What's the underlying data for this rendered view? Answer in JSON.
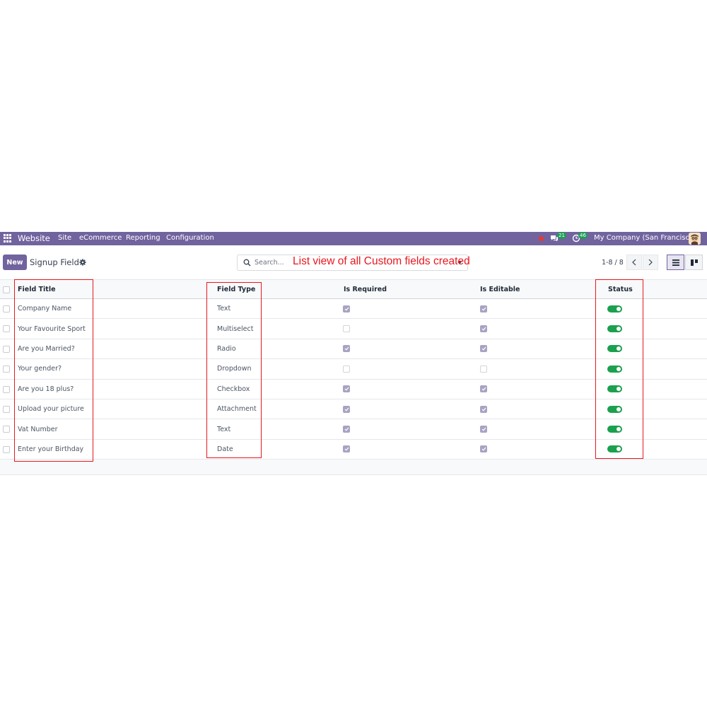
{
  "navbar": {
    "app_name": "Website",
    "menu": [
      "Site",
      "eCommerce",
      "Reporting",
      "Configuration"
    ],
    "messages_count": "21",
    "activities_count": "46",
    "company": "My Company (San Francisco)"
  },
  "control_panel": {
    "new_label": "New",
    "title": "Signup Field",
    "search_placeholder": "Search...",
    "pager_value": "1-8 / 8"
  },
  "annotation": {
    "text": "List view of all Custom fields created",
    "color": "#e8171f"
  },
  "table": {
    "headers": {
      "field_title": "Field Title",
      "field_type": "Field Type",
      "is_required": "Is Required",
      "is_editable": "Is Editable",
      "status": "Status"
    },
    "rows": [
      {
        "title": "Company Name",
        "type": "Text",
        "required": true,
        "editable": true,
        "status": true
      },
      {
        "title": "Your Favourite Sport",
        "type": "Multiselect",
        "required": false,
        "editable": true,
        "status": true
      },
      {
        "title": "Are you Married?",
        "type": "Radio",
        "required": true,
        "editable": true,
        "status": true
      },
      {
        "title": "Your gender?",
        "type": "Dropdown",
        "required": false,
        "editable": false,
        "status": true
      },
      {
        "title": "Are you 18 plus?",
        "type": "Checkbox",
        "required": true,
        "editable": true,
        "status": true
      },
      {
        "title": "Upload your picture",
        "type": "Attachment",
        "required": true,
        "editable": true,
        "status": true
      },
      {
        "title": "Vat Number",
        "type": "Text",
        "required": true,
        "editable": true,
        "status": true
      },
      {
        "title": "Enter your Birthday",
        "type": "Date",
        "required": true,
        "editable": true,
        "status": true
      }
    ]
  },
  "colors": {
    "navbar": "#71639e",
    "toggle_on": "#1ba04e",
    "checkbox_checked": "#a8a3c2"
  }
}
